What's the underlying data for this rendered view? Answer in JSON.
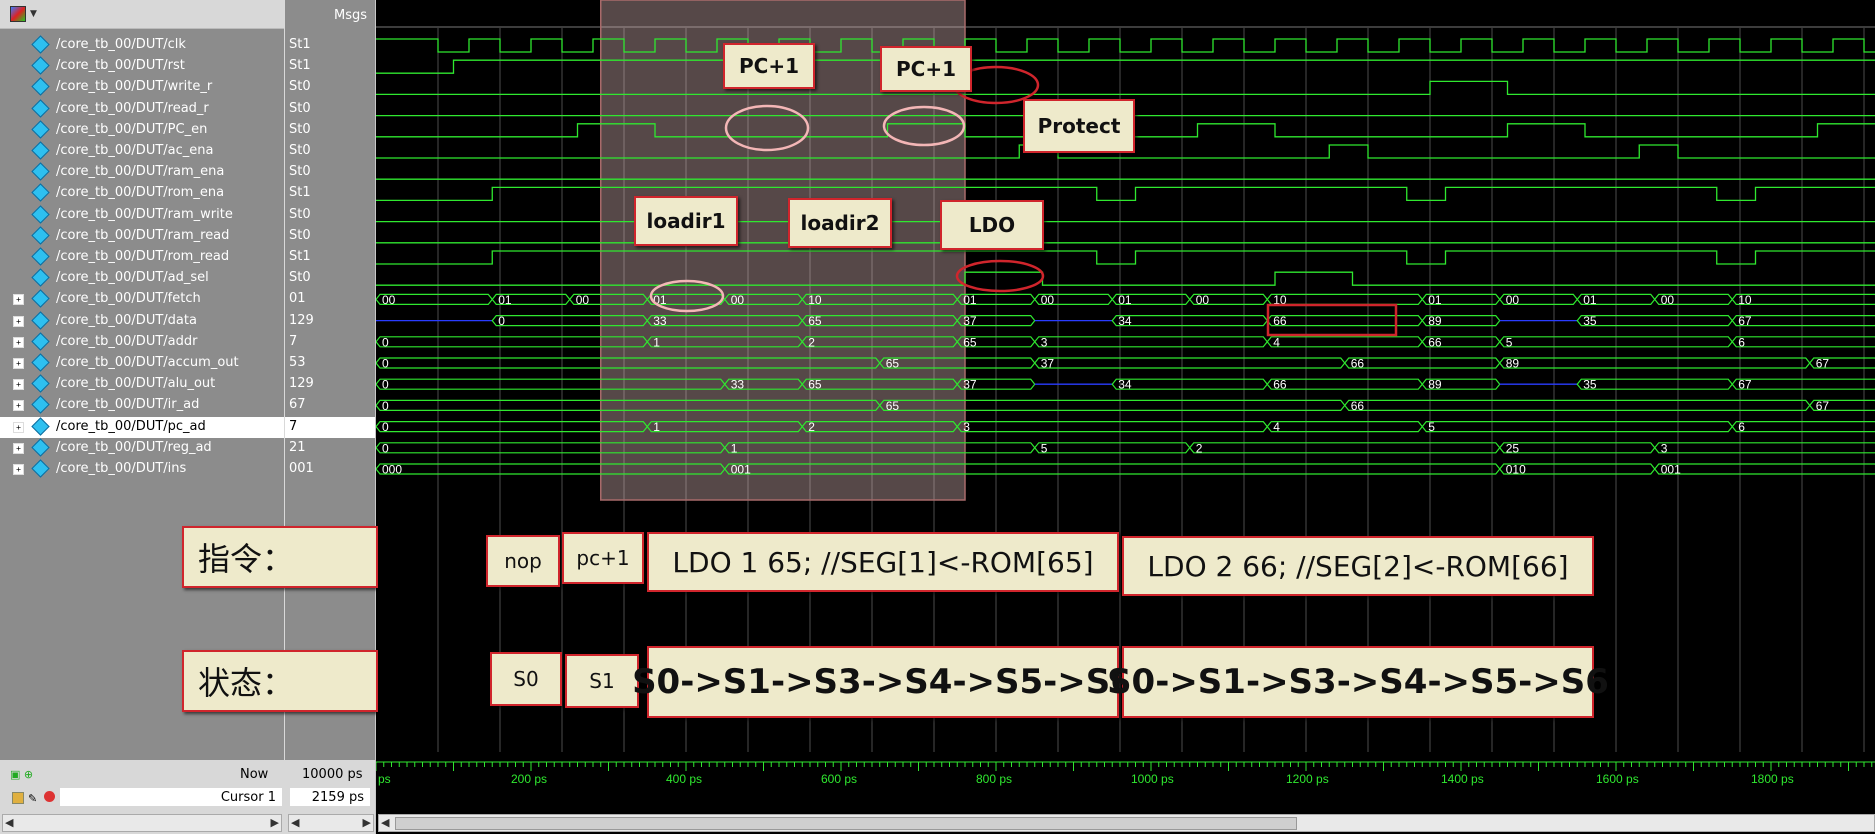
{
  "toolbar": {
    "icon": "wave-window-icon"
  },
  "header": {
    "msgs_label": "Msgs"
  },
  "signals": [
    {
      "name": "/core_tb_00/DUT/clk",
      "value": "St1",
      "type": "bit"
    },
    {
      "name": "/core_tb_00/DUT/rst",
      "value": "St1",
      "type": "bit"
    },
    {
      "name": "/core_tb_00/DUT/write_r",
      "value": "St0",
      "type": "bit"
    },
    {
      "name": "/core_tb_00/DUT/read_r",
      "value": "St0",
      "type": "bit"
    },
    {
      "name": "/core_tb_00/DUT/PC_en",
      "value": "St0",
      "type": "bit"
    },
    {
      "name": "/core_tb_00/DUT/ac_ena",
      "value": "St0",
      "type": "bit"
    },
    {
      "name": "/core_tb_00/DUT/ram_ena",
      "value": "St0",
      "type": "bit"
    },
    {
      "name": "/core_tb_00/DUT/rom_ena",
      "value": "St1",
      "type": "bit"
    },
    {
      "name": "/core_tb_00/DUT/ram_write",
      "value": "St0",
      "type": "bit"
    },
    {
      "name": "/core_tb_00/DUT/ram_read",
      "value": "St0",
      "type": "bit"
    },
    {
      "name": "/core_tb_00/DUT/rom_read",
      "value": "St1",
      "type": "bit"
    },
    {
      "name": "/core_tb_00/DUT/ad_sel",
      "value": "St0",
      "type": "bit"
    },
    {
      "name": "/core_tb_00/DUT/fetch",
      "value": "01",
      "type": "bus"
    },
    {
      "name": "/core_tb_00/DUT/data",
      "value": "129",
      "type": "bus"
    },
    {
      "name": "/core_tb_00/DUT/addr",
      "value": "7",
      "type": "bus"
    },
    {
      "name": "/core_tb_00/DUT/accum_out",
      "value": "53",
      "type": "bus"
    },
    {
      "name": "/core_tb_00/DUT/alu_out",
      "value": "129",
      "type": "bus"
    },
    {
      "name": "/core_tb_00/DUT/ir_ad",
      "value": "67",
      "type": "bus"
    },
    {
      "name": "/core_tb_00/DUT/pc_ad",
      "value": "7",
      "type": "bus",
      "selected": true
    },
    {
      "name": "/core_tb_00/DUT/reg_ad",
      "value": "21",
      "type": "bus"
    },
    {
      "name": "/core_tb_00/DUT/ins",
      "value": "001",
      "type": "bus"
    }
  ],
  "bit_waves": [
    [
      [
        0,
        1
      ],
      [
        80,
        0
      ],
      [
        120,
        1
      ],
      [
        160,
        0
      ],
      [
        200,
        1
      ],
      [
        240,
        0
      ],
      [
        280,
        1
      ],
      [
        320,
        0
      ],
      [
        360,
        1
      ],
      [
        400,
        0
      ],
      [
        440,
        1
      ],
      [
        480,
        0
      ],
      [
        520,
        1
      ],
      [
        560,
        0
      ],
      [
        600,
        1
      ],
      [
        640,
        0
      ],
      [
        680,
        1
      ],
      [
        720,
        0
      ],
      [
        760,
        1
      ],
      [
        800,
        0
      ],
      [
        840,
        1
      ],
      [
        880,
        0
      ],
      [
        920,
        1
      ],
      [
        960,
        0
      ],
      [
        1000,
        1
      ],
      [
        1040,
        0
      ],
      [
        1080,
        1
      ],
      [
        1120,
        0
      ],
      [
        1160,
        1
      ],
      [
        1200,
        0
      ],
      [
        1240,
        1
      ],
      [
        1280,
        0
      ],
      [
        1320,
        1
      ],
      [
        1360,
        0
      ],
      [
        1400,
        1
      ],
      [
        1440,
        0
      ],
      [
        1480,
        1
      ],
      [
        1520,
        0
      ],
      [
        1560,
        1
      ],
      [
        1600,
        0
      ],
      [
        1640,
        1
      ],
      [
        1680,
        0
      ],
      [
        1720,
        1
      ],
      [
        1760,
        0
      ],
      [
        1800,
        1
      ],
      [
        1840,
        0
      ],
      [
        1880,
        1
      ],
      [
        1920,
        0
      ]
    ],
    [
      [
        0,
        0
      ],
      [
        100,
        1
      ]
    ],
    [
      [
        0,
        0
      ],
      [
        1360,
        1
      ],
      [
        1460,
        0
      ]
    ],
    [
      [
        0,
        0
      ]
    ],
    [
      [
        0,
        0
      ],
      [
        260,
        1
      ],
      [
        360,
        0
      ],
      [
        660,
        1
      ],
      [
        760,
        0
      ],
      [
        1060,
        1
      ],
      [
        1160,
        0
      ],
      [
        1460,
        1
      ],
      [
        1560,
        0
      ],
      [
        1860,
        1
      ]
    ],
    [
      [
        0,
        0
      ],
      [
        830,
        1
      ],
      [
        880,
        0
      ],
      [
        1230,
        1
      ],
      [
        1280,
        0
      ],
      [
        1630,
        1
      ],
      [
        1680,
        0
      ]
    ],
    [
      [
        0,
        0
      ]
    ],
    [
      [
        0,
        0
      ],
      [
        150,
        1
      ],
      [
        930,
        0
      ],
      [
        980,
        1
      ],
      [
        1330,
        0
      ],
      [
        1380,
        1
      ],
      [
        1730,
        0
      ],
      [
        1780,
        1
      ]
    ],
    [
      [
        0,
        0
      ]
    ],
    [
      [
        0,
        0
      ]
    ],
    [
      [
        0,
        0
      ],
      [
        150,
        1
      ],
      [
        930,
        0
      ],
      [
        980,
        1
      ],
      [
        1330,
        0
      ],
      [
        1380,
        1
      ],
      [
        1730,
        0
      ],
      [
        1780,
        1
      ]
    ],
    [
      [
        0,
        0
      ],
      [
        760,
        1
      ],
      [
        860,
        0
      ],
      [
        1160,
        1
      ],
      [
        1260,
        0
      ]
    ]
  ],
  "bus_waves": [
    [
      [
        0,
        "00"
      ],
      [
        150,
        "01"
      ],
      [
        250,
        "00"
      ],
      [
        350,
        "01"
      ],
      [
        450,
        "00"
      ],
      [
        550,
        "10"
      ],
      [
        750,
        "01"
      ],
      [
        850,
        "00"
      ],
      [
        950,
        "01"
      ],
      [
        1050,
        "00"
      ],
      [
        1150,
        "10"
      ],
      [
        1350,
        "01"
      ],
      [
        1450,
        "00"
      ],
      [
        1550,
        "01"
      ],
      [
        1650,
        "00"
      ],
      [
        1750,
        "10"
      ]
    ],
    [
      [
        0,
        "",
        true
      ],
      [
        150,
        "0"
      ],
      [
        350,
        "33"
      ],
      [
        550,
        "65"
      ],
      [
        750,
        "37"
      ],
      [
        850,
        "",
        true
      ],
      [
        950,
        "34"
      ],
      [
        1150,
        "66"
      ],
      [
        1350,
        "89"
      ],
      [
        1450,
        "",
        true
      ],
      [
        1550,
        "35"
      ],
      [
        1750,
        "67"
      ]
    ],
    [
      [
        0,
        "0"
      ],
      [
        350,
        "1"
      ],
      [
        550,
        "2"
      ],
      [
        750,
        "65"
      ],
      [
        850,
        "3"
      ],
      [
        1150,
        "4"
      ],
      [
        1350,
        "66"
      ],
      [
        1450,
        "5"
      ],
      [
        1750,
        "6"
      ]
    ],
    [
      [
        0,
        "0"
      ],
      [
        650,
        "65"
      ],
      [
        850,
        "37"
      ],
      [
        1250,
        "66"
      ],
      [
        1450,
        "89"
      ],
      [
        1850,
        "67"
      ]
    ],
    [
      [
        0,
        "0"
      ],
      [
        450,
        "33"
      ],
      [
        550,
        "65"
      ],
      [
        750,
        "37"
      ],
      [
        850,
        "",
        true
      ],
      [
        950,
        "34"
      ],
      [
        1150,
        "66"
      ],
      [
        1350,
        "89"
      ],
      [
        1450,
        "",
        true
      ],
      [
        1550,
        "35"
      ],
      [
        1750,
        "67"
      ]
    ],
    [
      [
        0,
        "0"
      ],
      [
        650,
        "65"
      ],
      [
        1250,
        "66"
      ],
      [
        1850,
        "67"
      ]
    ],
    [
      [
        0,
        "0"
      ],
      [
        350,
        "1"
      ],
      [
        550,
        "2"
      ],
      [
        750,
        "3"
      ],
      [
        1150,
        "4"
      ],
      [
        1350,
        "5"
      ],
      [
        1750,
        "6"
      ]
    ],
    [
      [
        0,
        "0"
      ],
      [
        450,
        "1"
      ],
      [
        850,
        "5"
      ],
      [
        1050,
        "2"
      ],
      [
        1450,
        "25"
      ],
      [
        1650,
        "3"
      ]
    ],
    [
      [
        0,
        "000"
      ],
      [
        450,
        "001"
      ],
      [
        1450,
        "010"
      ],
      [
        1650,
        "001"
      ]
    ]
  ],
  "timeline": {
    "now_label": "Now",
    "now_value": "10000 ps",
    "cursor_label": "Cursor 1",
    "cursor_value": "2159 ps",
    "ticks": [
      {
        "t": 0,
        "label": "ps"
      },
      {
        "t": 200,
        "label": "200 ps"
      },
      {
        "t": 400,
        "label": "400 ps"
      },
      {
        "t": 600,
        "label": "600 ps"
      },
      {
        "t": 800,
        "label": "800 ps"
      },
      {
        "t": 1000,
        "label": "1000 ps"
      },
      {
        "t": 1200,
        "label": "1200 ps"
      },
      {
        "t": 1400,
        "label": "1400 ps"
      },
      {
        "t": 1600,
        "label": "1600 ps"
      },
      {
        "t": 1800,
        "label": "1800 ps"
      }
    ]
  },
  "annotations": {
    "pc1a": "PC+1",
    "pc1b": "PC+1",
    "protect": "Protect",
    "loadir1": "loadir1",
    "loadir2": "loadir2",
    "ldo": "LDO",
    "instr_title": "指令：",
    "state_title": "状态：",
    "nop": "nop",
    "pc1": "pc+1",
    "instr1": "LDO 1 65; //SEG[1]<-ROM[65]",
    "instr2": "LDO 2 66; //SEG[2]<-ROM[66]",
    "s0": "S0",
    "s1": "S1",
    "seq1": "S0->S1->S3->S4->S5->S6",
    "seq2": "S0->S1->S3->S4->S5->S6"
  },
  "colors": {
    "wave": "#2fe82f",
    "bus_z": "#2a3cff",
    "highlight": "#d0252c",
    "overlay": "rgba(225,190,190,0.38)"
  }
}
